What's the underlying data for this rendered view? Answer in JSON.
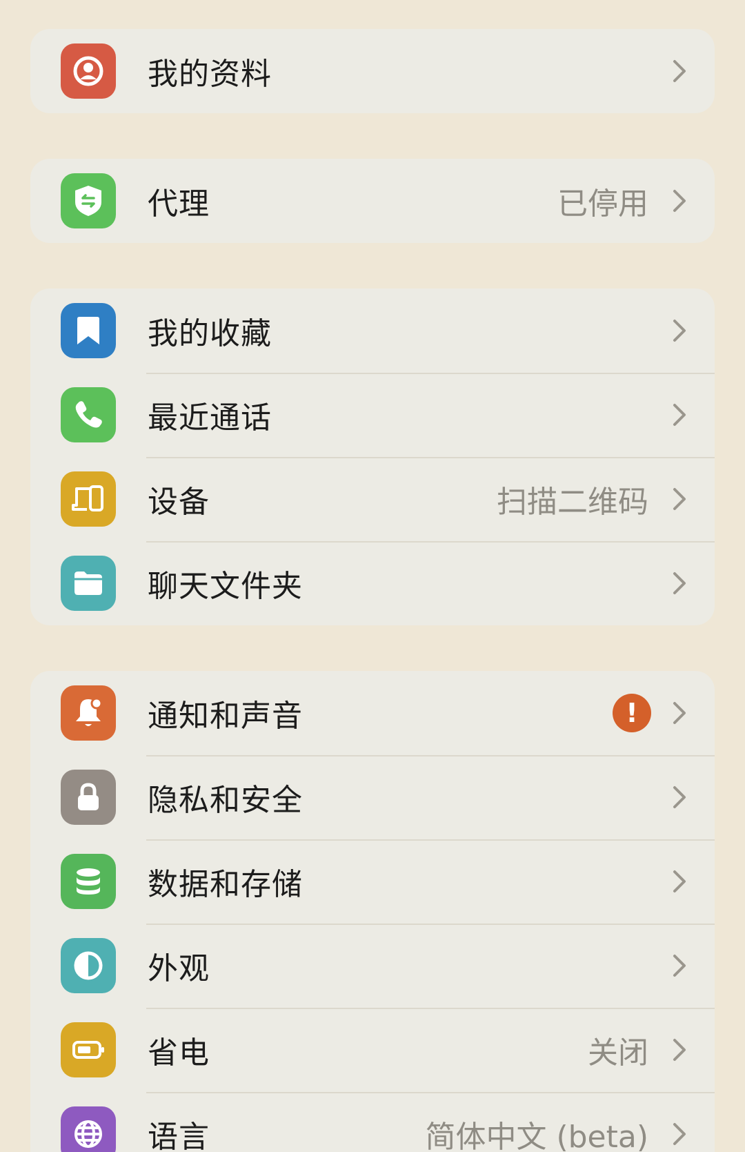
{
  "groups": [
    {
      "items": [
        {
          "label": "我的资料",
          "value": "",
          "icon": "profile-icon",
          "color": "#d65a44"
        }
      ]
    },
    {
      "items": [
        {
          "label": "代理",
          "value": "已停用",
          "icon": "proxy-shield-icon",
          "color": "#5cc05a"
        }
      ]
    },
    {
      "items": [
        {
          "label": "我的收藏",
          "value": "",
          "icon": "bookmark-icon",
          "color": "#2f7fc4"
        },
        {
          "label": "最近通话",
          "value": "",
          "icon": "phone-icon",
          "color": "#5cc05a"
        },
        {
          "label": "设备",
          "value": "扫描二维码",
          "icon": "devices-icon",
          "color": "#d9a826"
        },
        {
          "label": "聊天文件夹",
          "value": "",
          "icon": "folder-icon",
          "color": "#4fb0b2"
        }
      ]
    },
    {
      "items": [
        {
          "label": "通知和声音",
          "value": "",
          "badge": "!",
          "icon": "bell-icon",
          "color": "#d96a36"
        },
        {
          "label": "隐私和安全",
          "value": "",
          "icon": "lock-icon",
          "color": "#948c85"
        },
        {
          "label": "数据和存储",
          "value": "",
          "icon": "database-icon",
          "color": "#55b65a"
        },
        {
          "label": "外观",
          "value": "",
          "icon": "appearance-icon",
          "color": "#4fb0b2"
        },
        {
          "label": "省电",
          "value": "关闭",
          "icon": "battery-icon",
          "color": "#d9a826"
        },
        {
          "label": "语言",
          "value": "简体中文 (beta)",
          "icon": "globe-icon",
          "color": "#8e5ac0"
        }
      ]
    }
  ],
  "colors": {
    "background": "#efe7d6",
    "card": "#ecebe4",
    "separator": "#dcd8cc",
    "label": "#1c1c1c",
    "value": "#8f8c84",
    "chevron": "#9a968d",
    "badge": "#d4602a"
  }
}
